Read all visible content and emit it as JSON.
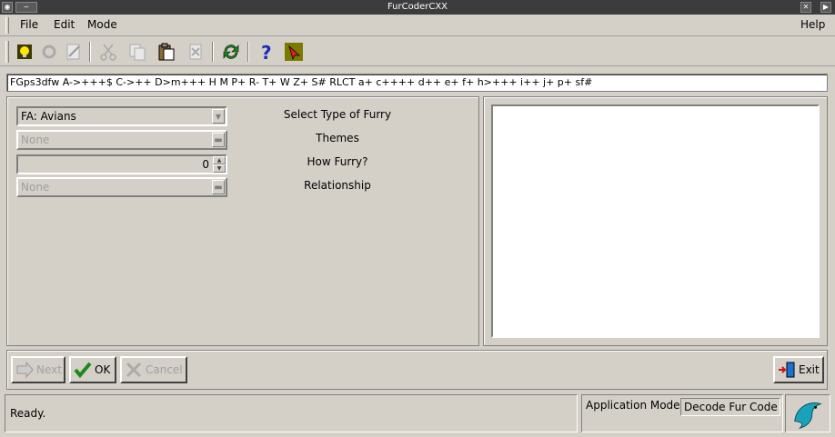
{
  "window": {
    "title": "FurCoderCXX"
  },
  "menubar": {
    "file": "File",
    "edit": "Edit",
    "mode": "Mode",
    "help": "Help"
  },
  "code_field": {
    "value": "FGps3dfw A->+++$ C->++ D>m+++ H M P+ R- T+ W Z+ S# RLCT a+ c++++ d++ e+ f+ h>+++ i++ j+ p+ sf#"
  },
  "form": {
    "type_value": "FA: Avians",
    "type_label": "Select Type of Furry",
    "themes_value": "None",
    "themes_label": "Themes",
    "furry_value": "0",
    "furry_label": "How Furry?",
    "relationship_value": "None",
    "relationship_label": "Relationship"
  },
  "buttons": {
    "next": "Next",
    "ok": "OK",
    "cancel": "Cancel",
    "exit": "Exit"
  },
  "status": {
    "text": "Ready.",
    "mode_label": "Application Mode",
    "mode_value": "Decode Fur Code"
  },
  "colors": {
    "titlebar": "#3c3c3c",
    "face": "#d4d0c8",
    "ok_green": "#1a8a1a",
    "exit_blue": "#1f6fd0"
  }
}
